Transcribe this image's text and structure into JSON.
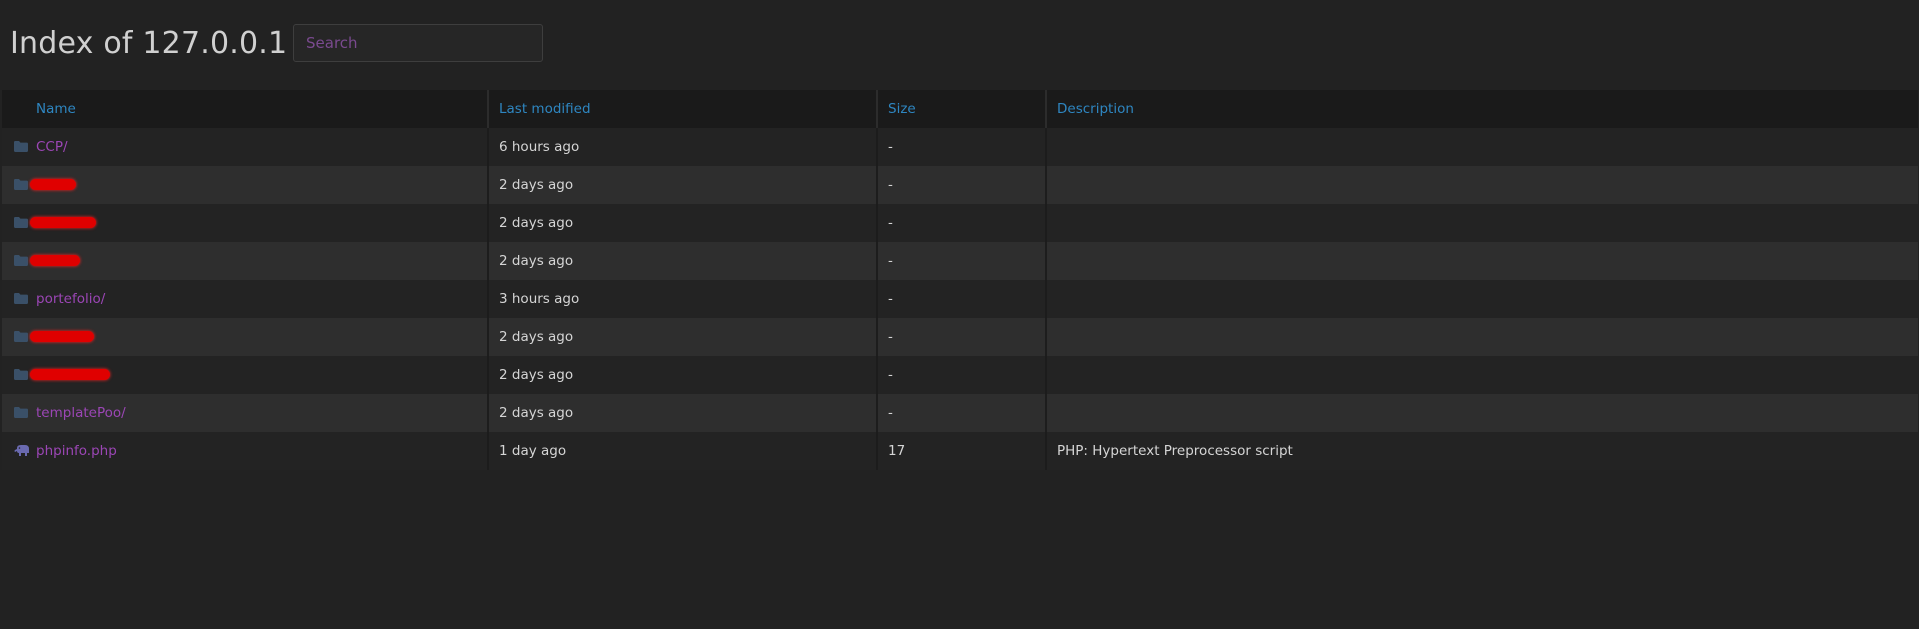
{
  "page": {
    "title": "Index of 127.0.0.1",
    "search_placeholder": "Search"
  },
  "table": {
    "headers": {
      "name": "Name",
      "last_modified": "Last modified",
      "size": "Size",
      "description": "Description"
    },
    "rows": [
      {
        "icon": "folder-icon",
        "name": "CCP/",
        "redacted": false,
        "modified": "6 hours ago",
        "size": "-",
        "description": ""
      },
      {
        "icon": "folder-icon",
        "name": "",
        "redacted": true,
        "modified": "2 days ago",
        "size": "-",
        "description": ""
      },
      {
        "icon": "folder-icon",
        "name": "",
        "redacted": true,
        "modified": "2 days ago",
        "size": "-",
        "description": ""
      },
      {
        "icon": "folder-icon",
        "name": "",
        "redacted": true,
        "modified": "2 days ago",
        "size": "-",
        "description": ""
      },
      {
        "icon": "folder-icon",
        "name": "portefolio/",
        "redacted": false,
        "modified": "3 hours ago",
        "size": "-",
        "description": ""
      },
      {
        "icon": "folder-icon",
        "name": "",
        "redacted": true,
        "modified": "2 days ago",
        "size": "-",
        "description": ""
      },
      {
        "icon": "folder-icon",
        "name": "",
        "redacted": true,
        "modified": "2 days ago",
        "size": "-",
        "description": ""
      },
      {
        "icon": "folder-icon",
        "name": "templatePoo/",
        "redacted": false,
        "modified": "2 days ago",
        "size": "-",
        "description": ""
      },
      {
        "icon": "php-elephant-icon",
        "name": "phpinfo.php",
        "redacted": false,
        "modified": "1 day ago",
        "size": "17",
        "description": "PHP: Hypertext Preprocessor script"
      }
    ]
  },
  "colors": {
    "background": "#222222",
    "header_text": "#2e86c1",
    "link": "#9b46b5",
    "redaction": "#e00000"
  }
}
